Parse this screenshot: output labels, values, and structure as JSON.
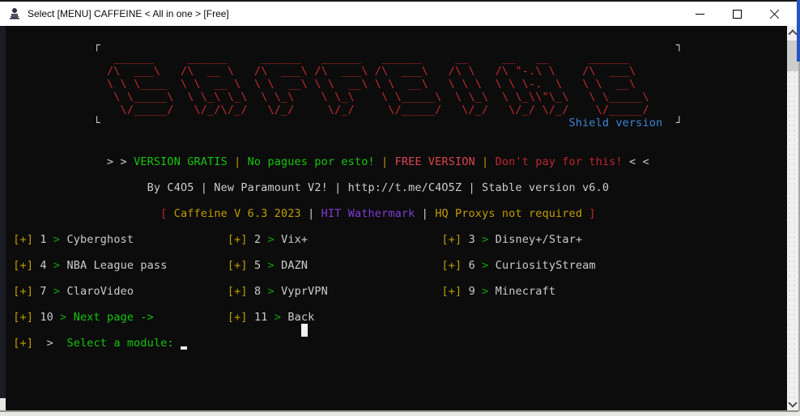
{
  "window": {
    "title": "Select [MENU] CAFFEINE < All in one > [Free]"
  },
  "icons": {
    "app": "hacker-console-app-icon",
    "minimize": "minimize-icon",
    "maximize": "maximize-icon",
    "close": "close-icon",
    "scroll_up": "scroll-up-arrow-icon",
    "scroll_down": "scroll-down-arrow-icon"
  },
  "colors": {
    "fg": "#cccccc",
    "red": "#c22b2b",
    "green": "#16c60c",
    "greenDim": "#13a10e",
    "gold": "#c19c00",
    "brightRed": "#dd4450",
    "darkRed": "#c02430",
    "purple": "#7d3bd4",
    "blue": "#3e86d8"
  },
  "terminal": {
    "lines": [
      {
        "row": 1,
        "name": "banner-frame-top",
        "segments": [
          {
            "t": "             ┌",
            "c": "fg"
          },
          {
            "t": "                                                                                      ",
            "c": "fg"
          },
          {
            "t": "┐",
            "c": "fg"
          }
        ]
      },
      {
        "row": 2,
        "name": "banner-line-1",
        "segments": [
          {
            "t": "               ",
            "c": "fg"
          },
          {
            "t": " ______    ",
            "c": "red"
          },
          {
            "t": " ______    ",
            "c": "red"
          },
          {
            "t": " ______  ",
            "c": "red"
          },
          {
            "t": " ______  ",
            "c": "red"
          },
          {
            "t": " ______    ",
            "c": "red"
          },
          {
            "t": " __    ",
            "c": "red"
          },
          {
            "t": " __   __     ",
            "c": "red"
          },
          {
            "t": " ______    ",
            "c": "red"
          }
        ]
      },
      {
        "row": 3,
        "name": "banner-line-2",
        "segments": [
          {
            "t": "               ",
            "c": "fg"
          },
          {
            "t": "/\\  ___\\   ",
            "c": "red"
          },
          {
            "t": "/\\  __ \\   ",
            "c": "red"
          },
          {
            "t": "/\\  ___\\ ",
            "c": "red"
          },
          {
            "t": "/\\  ___\\ ",
            "c": "red"
          },
          {
            "t": "/\\  ___\\   ",
            "c": "red"
          },
          {
            "t": "/\\ \\   ",
            "c": "red"
          },
          {
            "t": "/\\ \"-.\\ \\    ",
            "c": "red"
          },
          {
            "t": "/\\  ___\\   ",
            "c": "red"
          }
        ]
      },
      {
        "row": 4,
        "name": "banner-line-3",
        "segments": [
          {
            "t": "               ",
            "c": "fg"
          },
          {
            "t": "\\ \\ \\____  ",
            "c": "red"
          },
          {
            "t": "\\ \\  __ \\  ",
            "c": "red"
          },
          {
            "t": "\\ \\  __\\ ",
            "c": "red"
          },
          {
            "t": "\\ \\  __\\ ",
            "c": "red"
          },
          {
            "t": "\\ \\  __\\   ",
            "c": "red"
          },
          {
            "t": "\\ \\ \\  ",
            "c": "red"
          },
          {
            "t": "\\ \\ \\-.  \\   ",
            "c": "red"
          },
          {
            "t": "\\ \\  __\\   ",
            "c": "red"
          }
        ]
      },
      {
        "row": 5,
        "name": "banner-line-4",
        "segments": [
          {
            "t": "               ",
            "c": "fg"
          },
          {
            "t": " \\ \\_____\\ ",
            "c": "red"
          },
          {
            "t": " \\ \\_\\ \\_\\ ",
            "c": "red"
          },
          {
            "t": " \\ \\_\\   ",
            "c": "red"
          },
          {
            "t": " \\ \\_\\   ",
            "c": "red"
          },
          {
            "t": " \\ \\_____\\ ",
            "c": "red"
          },
          {
            "t": " \\ \\_\\ ",
            "c": "red"
          },
          {
            "t": " \\ \\_\\\\\"\\_\\  ",
            "c": "red"
          },
          {
            "t": " \\ \\_____\\ ",
            "c": "red"
          }
        ]
      },
      {
        "row": 6,
        "name": "banner-line-5",
        "segments": [
          {
            "t": "               ",
            "c": "fg"
          },
          {
            "t": "  \\/_____/ ",
            "c": "red"
          },
          {
            "t": "  \\/_/\\/_/ ",
            "c": "red"
          },
          {
            "t": "  \\/_/   ",
            "c": "red"
          },
          {
            "t": "  \\/_/   ",
            "c": "red"
          },
          {
            "t": "  \\/_____/ ",
            "c": "red"
          },
          {
            "t": "  \\/_/ ",
            "c": "red"
          },
          {
            "t": "  \\/_/ \\/_/  ",
            "c": "red"
          },
          {
            "t": "  \\/_____/ ",
            "c": "red"
          }
        ]
      },
      {
        "row": 7,
        "name": "banner-frame-bottom",
        "segments": [
          {
            "t": "             └",
            "c": "fg"
          },
          {
            "t": "                                                                      ",
            "c": "fg"
          },
          {
            "t": "Shield version",
            "c": "blue",
            "name": "shield-version-label"
          },
          {
            "t": "  ┘",
            "c": "fg"
          }
        ]
      },
      {
        "row": 10,
        "name": "tagline",
        "segments": [
          {
            "t": "               > > ",
            "c": "fg"
          },
          {
            "t": "VERSION GRATIS",
            "c": "green",
            "name": "tagline-version-gratis"
          },
          {
            "t": " | ",
            "c": "gold"
          },
          {
            "t": "No pagues por esto!",
            "c": "green",
            "name": "tagline-no-pagues"
          },
          {
            "t": " | ",
            "c": "gold"
          },
          {
            "t": "FREE VERSION",
            "c": "brightRed",
            "name": "tagline-free-version"
          },
          {
            "t": " | ",
            "c": "gold"
          },
          {
            "t": "Don't pay for this!",
            "c": "darkRed",
            "name": "tagline-dont-pay"
          },
          {
            "t": " < <",
            "c": "fg"
          }
        ]
      },
      {
        "row": 12,
        "name": "byline",
        "segments": [
          {
            "t": "                     ",
            "c": "fg"
          },
          {
            "t": "By C4O5 | New Paramount V2! | http://t.me/C4O5Z | Stable version v6.0",
            "c": "fg",
            "name": "byline-text"
          }
        ]
      },
      {
        "row": 14,
        "name": "version-line",
        "segments": [
          {
            "t": "                       ",
            "c": "fg"
          },
          {
            "t": "[",
            "c": "darkRed"
          },
          {
            "t": " ",
            "c": "fg"
          },
          {
            "t": "Caffeine V 6.3 2023",
            "c": "gold",
            "name": "version-caffeine"
          },
          {
            "t": " | ",
            "c": "fg"
          },
          {
            "t": "HIT Wathermark",
            "c": "purple",
            "name": "version-hit-wathermark"
          },
          {
            "t": " | ",
            "c": "fg"
          },
          {
            "t": "HQ Proxys not required",
            "c": "gold",
            "name": "version-hq-proxys"
          },
          {
            "t": " ",
            "c": "fg"
          },
          {
            "t": "]",
            "c": "darkRed"
          }
        ]
      },
      {
        "row": 16,
        "name": "menu-row-1",
        "segments": [
          {
            "t": " ",
            "c": "fg"
          },
          {
            "t": "[+]",
            "c": "gold"
          },
          {
            "t": " 1 ",
            "c": "fg"
          },
          {
            "t": "> ",
            "c": "greenDim"
          },
          {
            "t": "Cyberghost",
            "c": "fg",
            "name": "menu-item-1-label"
          },
          {
            "t": "              ",
            "c": "fg"
          },
          {
            "t": "[+]",
            "c": "gold"
          },
          {
            "t": " 2 ",
            "c": "fg"
          },
          {
            "t": "> ",
            "c": "greenDim"
          },
          {
            "t": "Vix+",
            "c": "fg",
            "name": "menu-item-2-label"
          },
          {
            "t": "                    ",
            "c": "fg"
          },
          {
            "t": "[+]",
            "c": "gold"
          },
          {
            "t": " 3 ",
            "c": "fg"
          },
          {
            "t": "> ",
            "c": "greenDim"
          },
          {
            "t": "Disney+/Star+",
            "c": "fg",
            "name": "menu-item-3-label"
          }
        ]
      },
      {
        "row": 18,
        "name": "menu-row-2",
        "segments": [
          {
            "t": " ",
            "c": "fg"
          },
          {
            "t": "[+]",
            "c": "gold"
          },
          {
            "t": " 4 ",
            "c": "fg"
          },
          {
            "t": "> ",
            "c": "greenDim"
          },
          {
            "t": "NBA League pass",
            "c": "fg",
            "name": "menu-item-4-label"
          },
          {
            "t": "         ",
            "c": "fg"
          },
          {
            "t": "[+]",
            "c": "gold"
          },
          {
            "t": " 5 ",
            "c": "fg"
          },
          {
            "t": "> ",
            "c": "greenDim"
          },
          {
            "t": "DAZN",
            "c": "fg",
            "name": "menu-item-5-label"
          },
          {
            "t": "                    ",
            "c": "fg"
          },
          {
            "t": "[+]",
            "c": "gold"
          },
          {
            "t": " 6 ",
            "c": "fg"
          },
          {
            "t": "> ",
            "c": "greenDim"
          },
          {
            "t": "CuriosityStream",
            "c": "fg",
            "name": "menu-item-6-label"
          }
        ]
      },
      {
        "row": 20,
        "name": "menu-row-3",
        "segments": [
          {
            "t": " ",
            "c": "fg"
          },
          {
            "t": "[+]",
            "c": "gold"
          },
          {
            "t": " 7 ",
            "c": "fg"
          },
          {
            "t": "> ",
            "c": "greenDim"
          },
          {
            "t": "ClaroVideo",
            "c": "fg",
            "name": "menu-item-7-label"
          },
          {
            "t": "              ",
            "c": "fg"
          },
          {
            "t": "[+]",
            "c": "gold"
          },
          {
            "t": " 8 ",
            "c": "fg"
          },
          {
            "t": "> ",
            "c": "greenDim"
          },
          {
            "t": "VyprVPN",
            "c": "fg",
            "name": "menu-item-8-label"
          },
          {
            "t": "                 ",
            "c": "fg"
          },
          {
            "t": "[+]",
            "c": "gold"
          },
          {
            "t": " 9 ",
            "c": "fg"
          },
          {
            "t": "> ",
            "c": "greenDim"
          },
          {
            "t": "Minecraft",
            "c": "fg",
            "name": "menu-item-9-label"
          }
        ]
      },
      {
        "row": 22,
        "name": "menu-row-4",
        "segments": [
          {
            "t": " ",
            "c": "fg"
          },
          {
            "t": "[+]",
            "c": "gold"
          },
          {
            "t": " 10 ",
            "c": "fg"
          },
          {
            "t": "> ",
            "c": "greenDim"
          },
          {
            "t": "Next page ->",
            "c": "green",
            "name": "menu-item-10-label"
          },
          {
            "t": "           ",
            "c": "fg"
          },
          {
            "t": "[+]",
            "c": "gold"
          },
          {
            "t": " 11 ",
            "c": "fg"
          },
          {
            "t": "> ",
            "c": "greenDim"
          },
          {
            "t": "Back",
            "c": "fg",
            "name": "menu-item-11-label"
          }
        ]
      },
      {
        "row": 23,
        "name": "stray-block-cursor-line",
        "segments": [
          {
            "t": "                                            ",
            "c": "fg"
          },
          {
            "t": " ",
            "c": "fg",
            "cursor": "block",
            "name": "stray-block-cursor"
          }
        ]
      },
      {
        "row": 24,
        "name": "prompt-line",
        "segments": [
          {
            "t": " ",
            "c": "fg"
          },
          {
            "t": "[+]",
            "c": "gold"
          },
          {
            "t": "  ",
            "c": "fg"
          },
          {
            "t": ">",
            "c": "fg"
          },
          {
            "t": "  ",
            "c": "fg"
          },
          {
            "t": "Select a module:",
            "c": "green",
            "name": "prompt-label"
          },
          {
            "t": " ",
            "c": "fg"
          },
          {
            "t": " ",
            "c": "fg",
            "cursor": "underscore",
            "name": "prompt-cursor"
          }
        ]
      }
    ]
  }
}
